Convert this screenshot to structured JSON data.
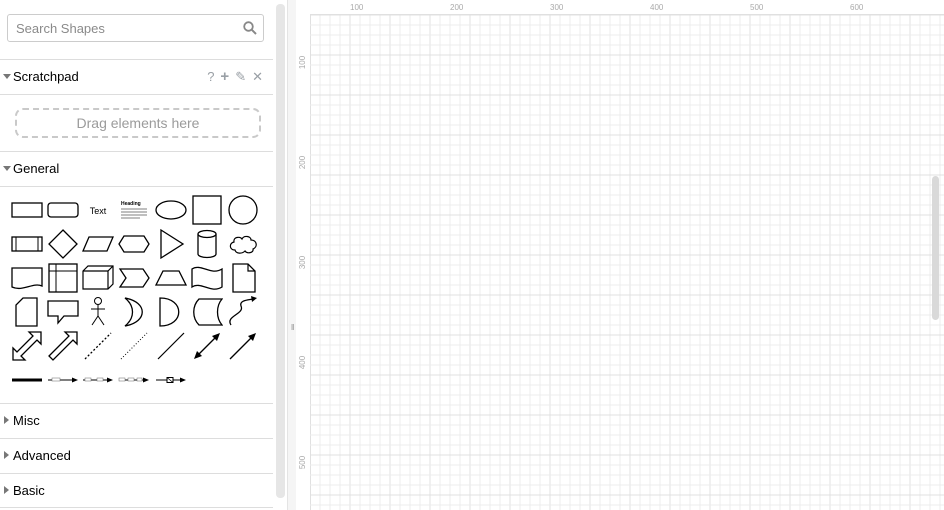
{
  "sidebar": {
    "search": {
      "placeholder": "Search Shapes"
    },
    "scratchpad": {
      "label": "Scratchpad",
      "tools": {
        "help": "?",
        "add": "+",
        "edit": "✎",
        "close": "✕"
      },
      "drop_hint": "Drag elements here"
    },
    "general": {
      "label": "General",
      "text_shape": "Text",
      "heading_shape": "Heading"
    },
    "sections": [
      {
        "label": "Misc"
      },
      {
        "label": "Advanced"
      },
      {
        "label": "Basic"
      }
    ]
  },
  "canvas": {
    "hruler": [
      "100",
      "200",
      "300",
      "400",
      "500",
      "600"
    ],
    "vruler": [
      "100",
      "200",
      "300",
      "400",
      "500"
    ],
    "grid_color": "#ececec",
    "major_grid_color": "#e0e0e0"
  },
  "colors": {
    "accent": "#777777",
    "border": "#dddddd"
  }
}
